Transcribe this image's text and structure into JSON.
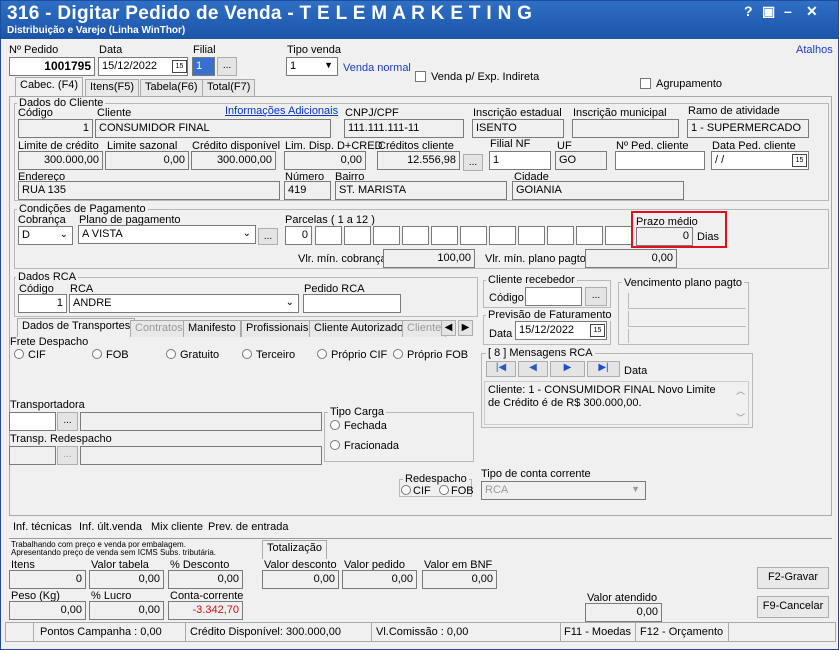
{
  "window": {
    "title": "316 - Digitar Pedido de Venda - T E L E M A R K E T I N G",
    "subtitle": "Distribuição e Varejo (Linha WinThor)",
    "help": "?",
    "restore": "▣",
    "minimize": "–",
    "close": "✕"
  },
  "header": {
    "pedido_label": "Nº Pedido",
    "pedido_value": "1001795",
    "data_label": "Data",
    "data_value": "15/12/2022",
    "filial_label": "Filial",
    "filial_value": "1",
    "ellipsis": "...",
    "tipo_venda_label": "Tipo venda",
    "tipo_venda_value": "1",
    "tipo_venda_desc": "Venda normal",
    "venda_indireta_label": "Venda p/ Exp. Indireta",
    "agrupamento_label": "Agrupamento",
    "atalhos": "Atalhos",
    "cal_glyph": "15"
  },
  "tabs": [
    "Cabec. (F4)",
    "Itens(F5)",
    "Tabela(F6)",
    "Total(F7)"
  ],
  "cliente": {
    "group": "Dados do Cliente",
    "codigo_label": "Código",
    "codigo": "1",
    "cliente_label": "Cliente",
    "cliente": "CONSUMIDOR FINAL",
    "info_link": "Informações Adicionais",
    "cnpj_label": "CNPJ/CPF",
    "cnpj": "111.111.111-11",
    "ie_label": "Inscrição estadual",
    "ie": "ISENTO",
    "im_label": "Inscrição municipal",
    "im": "",
    "ramo_label": "Ramo de atividade",
    "ramo": "1 - SUPERMERCADO",
    "limite_label": "Limite de crédito",
    "limite": "300.000,00",
    "sazonal_label": "Limite sazonal",
    "sazonal": "0,00",
    "disp_label": "Crédito disponível",
    "disp": "300.000,00",
    "limdisp_label": "Lim. Disp. D+CRED",
    "limdisp": "0,00",
    "creditos_label": "Créditos cliente",
    "creditos": "12.556,98",
    "filialnf_label": "Filial NF",
    "filialnf": "1",
    "uf_label": "UF",
    "uf": "GO",
    "nped_label": "Nº Ped. cliente",
    "nped": "",
    "dataped_label": "Data Ped. cliente",
    "dataped": " / /",
    "end_label": "Endereço",
    "end": "RUA 135",
    "num_label": "Número",
    "num": "419",
    "bairro_label": "Bairro",
    "bairro": "ST. MARISTA",
    "cidade_label": "Cidade",
    "cidade": "GOIANIA"
  },
  "pagamento": {
    "group": "Condições de Pagamento",
    "cobranca_label": "Cobrança",
    "cobranca": "D",
    "plano_label": "Plano de pagamento",
    "plano": "A VISTA",
    "parcelas_label": "Parcelas ( 1 a 12 )",
    "parcela1": "0",
    "prazo_label": "Prazo médio",
    "prazo": "0",
    "dias": "Dias",
    "vlcob_label": "Vlr. mín. cobrança",
    "vlcob": "100,00",
    "vlplano_label": "Vlr. mín. plano pagto.",
    "vlplano": "0,00"
  },
  "rca": {
    "group": "Dados RCA",
    "codigo_label": "Código",
    "codigo": "1",
    "rca_label": "RCA",
    "rca": "ANDRE",
    "pedido_label": "Pedido RCA",
    "pedido": ""
  },
  "receb": {
    "group": "Cliente recebedor",
    "codigo_label": "Código",
    "prev_group": "Previsão de Faturamento",
    "data_label": "Data",
    "data": "15/12/2022",
    "venc_group": "Vencimento plano pagto"
  },
  "tabs2": [
    "Dados de Transportes",
    "Contratos",
    "Manifesto",
    "Profissionais",
    "Cliente Autorizado",
    "Cliente"
  ],
  "frete": {
    "label": "Frete Despacho",
    "options": [
      "CIF",
      "FOB",
      "Gratuito",
      "Terceiro",
      "Próprio CIF",
      "Próprio FOB"
    ]
  },
  "mensagens": {
    "group": "[ 8 ] Mensagens RCA",
    "data_label": "Data",
    "text": "Cliente: 1 - CONSUMIDOR FINAL  Novo Limite de Crédito é de R$ 300.000,00."
  },
  "transp": {
    "label": "Transportadora",
    "redesp_label": "Transp. Redespacho",
    "tipo_carga": "Tipo Carga",
    "fechada": "Fechada",
    "fracionada": "Fracionada",
    "redespacho": "Redespacho",
    "cif": "CIF",
    "fob": "FOB",
    "conta_label": "Tipo de conta corrente",
    "conta": "RCA"
  },
  "links": [
    "Inf. técnicas",
    "Inf. últ.venda",
    "Mix cliente",
    "Prev. de entrada"
  ],
  "totals": {
    "note1": "Trabalhando com preço e venda por embalagem.",
    "note2": "Apresentando preço de venda sem ICMS Subs. tributária.",
    "tab": "Totalização",
    "itens_label": "Itens",
    "itens": "0",
    "vtab_label": "Valor tabela",
    "vtab": "0,00",
    "desc_label": "% Desconto",
    "desc": "0,00",
    "vdesc_label": "Valor desconto",
    "vdesc": "0,00",
    "vped_label": "Valor pedido",
    "vped": "0,00",
    "bnf_label": "Valor em BNF",
    "bnf": "0,00",
    "peso_label": "Peso (Kg)",
    "peso": "0,00",
    "lucro_label": "% Lucro",
    "lucro": "0,00",
    "cc_label": "Conta-corrente",
    "cc": "-3.342,70",
    "vat_label": "Valor atendido",
    "vat": "0,00",
    "gravar": "F2-Gravar",
    "cancelar": "F9-Cancelar"
  },
  "status": {
    "pontos": "Pontos Campanha : 0,00",
    "credito": "Crédito Disponível: 300.000,00",
    "comissao": "Vl.Comissão : 0,00",
    "f11": "F11 - Moedas",
    "f12": "F12 - Orçamento"
  },
  "colors": {
    "title": "#1b55a8",
    "highlight": "#e0101a",
    "negative": "#d01010"
  }
}
